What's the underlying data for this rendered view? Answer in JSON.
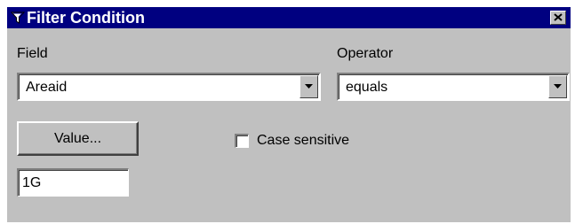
{
  "window": {
    "title": "Filter Condition",
    "title_icon": "filter-funnel-icon",
    "close_icon": "close-icon"
  },
  "field": {
    "label": "Field",
    "selected": "Areaid"
  },
  "operator": {
    "label": "Operator",
    "selected": "equals"
  },
  "value_button": {
    "label": "Value..."
  },
  "case_sensitive": {
    "label": "Case sensitive",
    "checked": false
  },
  "value_input": {
    "value": "1G"
  },
  "colors": {
    "titlebar": "#000080",
    "face": "#c0c0c0",
    "field_bg": "#ffffff"
  }
}
